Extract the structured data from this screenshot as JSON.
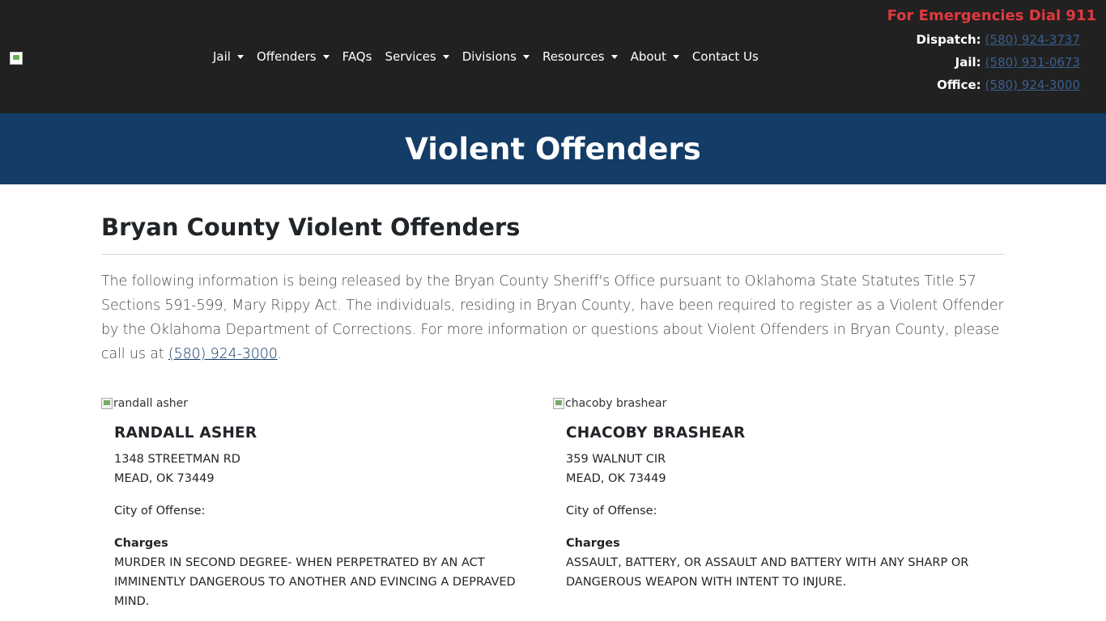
{
  "header": {
    "logo": "site-logo",
    "nav": [
      {
        "label": "Jail",
        "dropdown": true
      },
      {
        "label": "Offenders",
        "dropdown": true
      },
      {
        "label": "FAQs",
        "dropdown": false
      },
      {
        "label": "Services",
        "dropdown": true
      },
      {
        "label": "Divisions",
        "dropdown": true
      },
      {
        "label": "Resources",
        "dropdown": true
      },
      {
        "label": "About",
        "dropdown": true
      },
      {
        "label": "Contact Us",
        "dropdown": false
      }
    ],
    "emergency": "For Emergencies Dial 911",
    "contacts": [
      {
        "label": "Dispatch:",
        "phone": "(580) 924-3737"
      },
      {
        "label": "Jail:",
        "phone": "(580) 931-0673"
      },
      {
        "label": "Office:",
        "phone": "(580) 924-3000"
      }
    ]
  },
  "banner": {
    "title": "Violent Offenders"
  },
  "main": {
    "title": "Bryan County Violent Offenders",
    "intro": "The following information is being released by the Bryan County Sheriff's Office pursuant to Oklahoma State Statutes Title 57 Sections 591-599, Mary Rippy Act. The individuals, residing in Bryan County, have been required to register as a Violent Offender by the Oklahoma Department of Corrections. For more information or questions about Violent Offenders in Bryan County, please call us at ",
    "intro_phone": "(580) 924-3000",
    "intro_end": ".",
    "offenders": [
      {
        "img_alt": "randall asher",
        "name": "RANDALL ASHER",
        "address1": "1348 STREETMAN RD",
        "address2": "MEAD, OK 73449",
        "city_label": "City of Offense:",
        "charges_label": "Charges",
        "charges": "MURDER IN SECOND DEGREE- WHEN PERPETRATED BY AN ACT IMMINENTLY DANGEROUS TO ANOTHER AND EVINCING A DEPRAVED MIND."
      },
      {
        "img_alt": "chacoby brashear",
        "name": "CHACOBY BRASHEAR",
        "address1": "359 WALNUT CIR",
        "address2": "MEAD, OK 73449",
        "city_label": "City of Offense:",
        "charges_label": "Charges",
        "charges": "ASSAULT, BATTERY, OR ASSAULT AND BATTERY WITH ANY SHARP OR DANGEROUS WEAPON WITH INTENT TO INJURE."
      }
    ]
  },
  "colors": {
    "topbar": "#212121",
    "banner": "#133c66",
    "emergency": "#e03a3e",
    "link": "#3a5f8f"
  }
}
